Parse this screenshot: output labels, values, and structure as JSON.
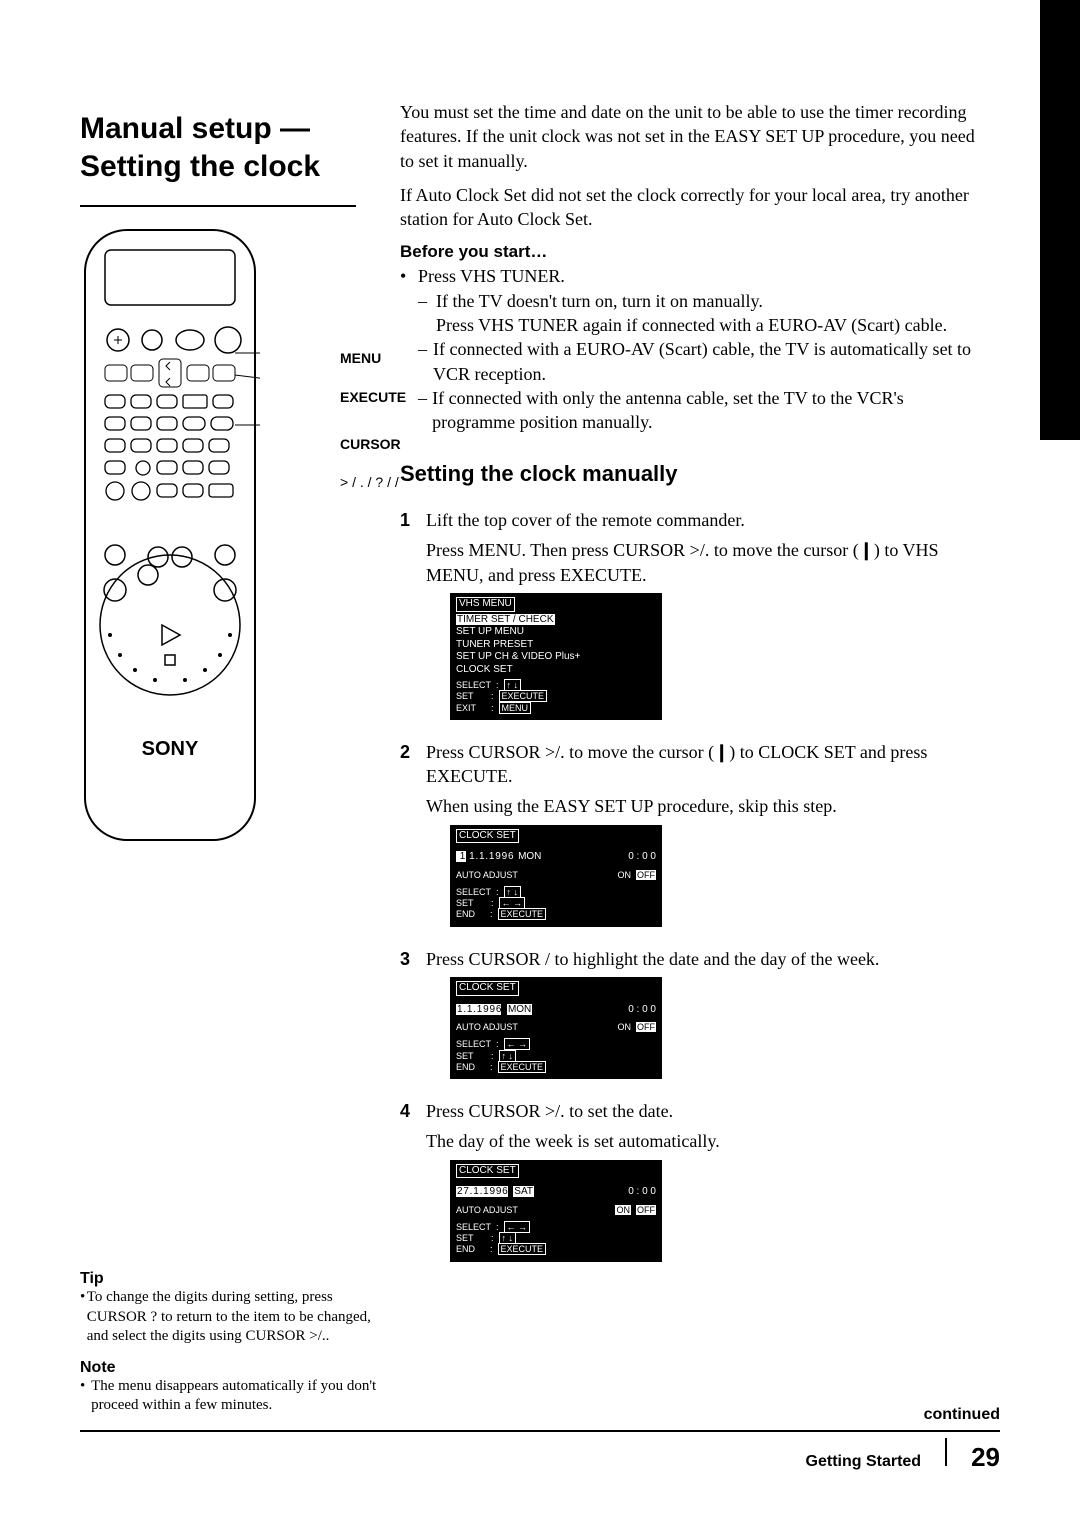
{
  "side_tab": "Getting Started",
  "title": "Manual setup — Setting the clock",
  "remote_labels": {
    "menu": "MENU",
    "execute": "EXECUTE",
    "cursor": "CURSOR",
    "cursor_sub": "> / . / ? / /"
  },
  "sony": "SONY",
  "tip_heading": "Tip",
  "tip_body": "To change the digits during setting, press CURSOR ? to return to the item to be changed, and select the digits using CURSOR >/..",
  "note_heading": "Note",
  "note_body": "The menu disappears automatically if you don't proceed within a few minutes.",
  "intro1": "You must set the time and date on the unit to be able to use the timer recording features.  If the unit clock was not set in the EASY SET UP procedure, you need to set it manually.",
  "intro2": "If Auto Clock Set did not set the clock correctly for your local area, try another station for Auto Clock Set.",
  "before_heading": "Before you start…",
  "before_bullet": "Press VHS TUNER.",
  "before_dash1a": "If the TV doesn't turn on, turn it on manually.",
  "before_dash1b": "Press VHS TUNER again if connected with a EURO-AV (Scart) cable.",
  "before_dash2": "If connected with a EURO-AV (Scart) cable, the TV is automatically set to VCR reception.",
  "before_dash3": "If connected with only the antenna cable, set the TV to the VCR's programme position manually.",
  "sub_heading": "Setting the clock manually",
  "steps": {
    "s1a": "Lift the top cover of the remote commander.",
    "s1b": "Press MENU.  Then press CURSOR >/. to move the cursor (❙) to VHS MENU, and press EXECUTE.",
    "s2a": "Press CURSOR >/. to move the cursor (❙) to CLOCK SET and press EXECUTE.",
    "s2b": "When using the EASY SET UP procedure, skip this step.",
    "s3": "Press CURSOR / to highlight the date and the day of the week.",
    "s4a": "Press CURSOR >/. to set the date.",
    "s4b": "The day of the week is set automatically."
  },
  "osd1": {
    "title": "VHS MENU",
    "items": [
      "TIMER SET / CHECK",
      "SET UP MENU",
      "TUNER PRESET",
      "SET UP CH & VIDEO Plus+",
      "CLOCK SET"
    ],
    "select": "SELECT",
    "set": "SET",
    "exit": "EXIT",
    "execute": "EXECUTE",
    "menu": "MENU"
  },
  "osd2": {
    "title": "CLOCK SET",
    "date": "1 . 1 . 1 9 9 6",
    "day": "MON",
    "time": "0 : 0 0",
    "auto": "AUTO ADJUST",
    "on": "ON",
    "off": "OFF",
    "select": "SELECT",
    "set": "SET",
    "end": "END",
    "execute": "EXECUTE"
  },
  "osd3": {
    "title": "CLOCK SET",
    "date": "1 . 1 . 1 9 9 6",
    "day": "MON",
    "time": "0 : 0 0",
    "auto": "AUTO ADJUST",
    "on": "ON",
    "off": "OFF",
    "select": "SELECT",
    "set": "SET",
    "end": "END",
    "execute": "EXECUTE"
  },
  "osd4": {
    "title": "CLOCK SET",
    "date": "2 7 . 1 . 1 9 9 6",
    "day": "SAT",
    "time": "0 : 0 0",
    "auto": "AUTO ADJUST",
    "on": "ON",
    "off": "OFF",
    "select": "SELECT",
    "set": "SET",
    "end": "END",
    "execute": "EXECUTE"
  },
  "footer": {
    "continued": "continued",
    "section": "Getting Started",
    "page": "29"
  }
}
